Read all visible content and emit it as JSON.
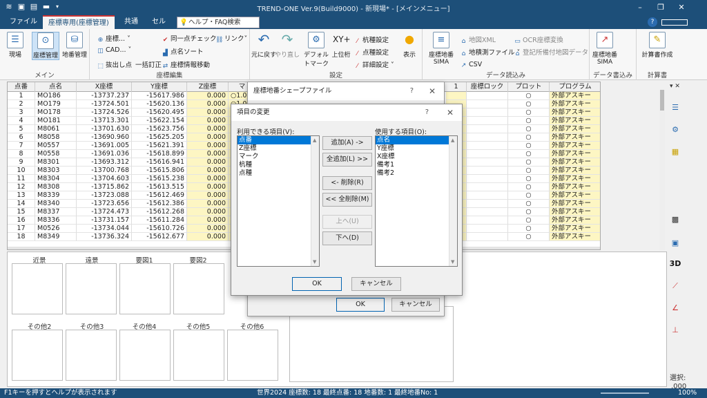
{
  "window": {
    "title": "TREND-ONE Ver.9(Build9000) - 新現場* - [メインメニュー]"
  },
  "tabs": [
    {
      "label": "ファイル"
    },
    {
      "label": "座標専用(座標管理)",
      "active": true
    },
    {
      "label": "共通"
    },
    {
      "label": "セル"
    }
  ],
  "help_search": {
    "placeholder": "ヘルプ・FAQ検索"
  },
  "ribbon": {
    "main": {
      "label": "メイン",
      "items": [
        "現場",
        "座標管理",
        "地番管理"
      ]
    },
    "coord_edit": {
      "label": "座標編集",
      "items": [
        "座標...",
        "CAD...",
        "抜出し点",
        "一括訂正",
        "同一点チェック",
        "点名ソート",
        "座標情報移動",
        "リンク"
      ]
    },
    "settings": {
      "label": "設定",
      "items": [
        "元に戻す",
        "やり直し",
        "デフォルトマーク",
        "上位桁",
        "杭種設定",
        "点種設定",
        "詳細設定",
        "表示"
      ]
    },
    "data_load": {
      "label": "データ読込み",
      "items": [
        "座標地番SIMA",
        "CSV",
        "地図XML",
        "地積測ファイル",
        "OCR座標変換",
        "登記所備付地図データ"
      ]
    },
    "data_write": {
      "label": "データ書込み",
      "items": [
        "座標地番SIMA"
      ]
    },
    "calc": {
      "label": "計算書",
      "items": [
        "計算書作成"
      ]
    }
  },
  "grid": {
    "columns": [
      "点番",
      "点名",
      "X座標",
      "Y座標",
      "Z座標",
      "マ",
      "1",
      "座標ロック",
      "プロット",
      "プログラム"
    ],
    "rows": [
      [
        "1",
        "MO186",
        "-13737.237",
        "-15617.986",
        "0.000",
        "1.0"
      ],
      [
        "2",
        "MO179",
        "-13724.501",
        "-15620.136",
        "0.000",
        "1.0"
      ],
      [
        "3",
        "MO178",
        "-13724.526",
        "-15620.495",
        "0.000",
        ""
      ],
      [
        "4",
        "MO181",
        "-13713.301",
        "-15622.154",
        "0.000",
        ""
      ],
      [
        "5",
        "M8061",
        "-13701.630",
        "-15623.756",
        "0.000",
        ""
      ],
      [
        "6",
        "M8058",
        "-13690.960",
        "-15625.205",
        "0.000",
        ""
      ],
      [
        "7",
        "M0557",
        "-13691.005",
        "-15621.391",
        "0.000",
        ""
      ],
      [
        "8",
        "M0558",
        "-13691.036",
        "-15618.899",
        "0.000",
        ""
      ],
      [
        "9",
        "M8301",
        "-13693.312",
        "-15616.941",
        "0.000",
        ""
      ],
      [
        "10",
        "M8303",
        "-13700.768",
        "-15615.806",
        "0.000",
        ""
      ],
      [
        "11",
        "M8304",
        "-13704.603",
        "-15615.238",
        "0.000",
        ""
      ],
      [
        "12",
        "M8308",
        "-13715.862",
        "-15613.515",
        "0.000",
        ""
      ],
      [
        "13",
        "M8339",
        "-13723.088",
        "-15612.469",
        "0.000",
        ""
      ],
      [
        "14",
        "M8340",
        "-13723.656",
        "-15612.386",
        "0.000",
        ""
      ],
      [
        "15",
        "M8337",
        "-13724.473",
        "-15612.268",
        "0.000",
        ""
      ],
      [
        "16",
        "M8336",
        "-13731.157",
        "-15611.284",
        "0.000",
        ""
      ],
      [
        "17",
        "M0526",
        "-13734.044",
        "-15610.726",
        "0.000",
        ""
      ],
      [
        "18",
        "M8349",
        "-13736.324",
        "-15612.677",
        "0.000",
        ""
      ]
    ],
    "plot_symbol": "○",
    "program": "外部アスキー"
  },
  "thumbs": {
    "row1": [
      "近景",
      "遠景",
      "要図1",
      "要図2"
    ],
    "row2": [
      "その他2",
      "その他3",
      "その他4",
      "その他5",
      "その他6"
    ]
  },
  "outer_dialog": {
    "title": "座標地番シェープファイル",
    "ok": "OK",
    "cancel": "キャンセル"
  },
  "inner_dialog": {
    "title": "項目の変更",
    "available_label": "利用できる項目(V):",
    "available": [
      "点番",
      "Z座標",
      "マーク",
      "杭種",
      "点種"
    ],
    "used_label": "使用する項目(O):",
    "used": [
      "点名",
      "Y座標",
      "X座標",
      "備考1",
      "備考2"
    ],
    "buttons": {
      "add": "追加(A) ->",
      "add_all": "全追加(L) >>",
      "remove": "<- 削除(R)",
      "remove_all": "<< 全削除(M)",
      "up": "上へ(U)",
      "down": "下へ(D)",
      "ok": "OK",
      "cancel": "キャンセル"
    }
  },
  "side": {
    "select_label": "選択:",
    "select_value": ".000",
    "view3d": "3D"
  },
  "status": {
    "text": "F1キーを押すとヘルプが表示されます",
    "center": "世界2024  座標数: 18  最終点番: 18  地番数: 1  最終地番No: 1",
    "zoom": "100%"
  },
  "colors": {
    "title_bar": "#1d4f79",
    "accent": "#0078d7",
    "yellow_cell": "#fdf6c3"
  }
}
